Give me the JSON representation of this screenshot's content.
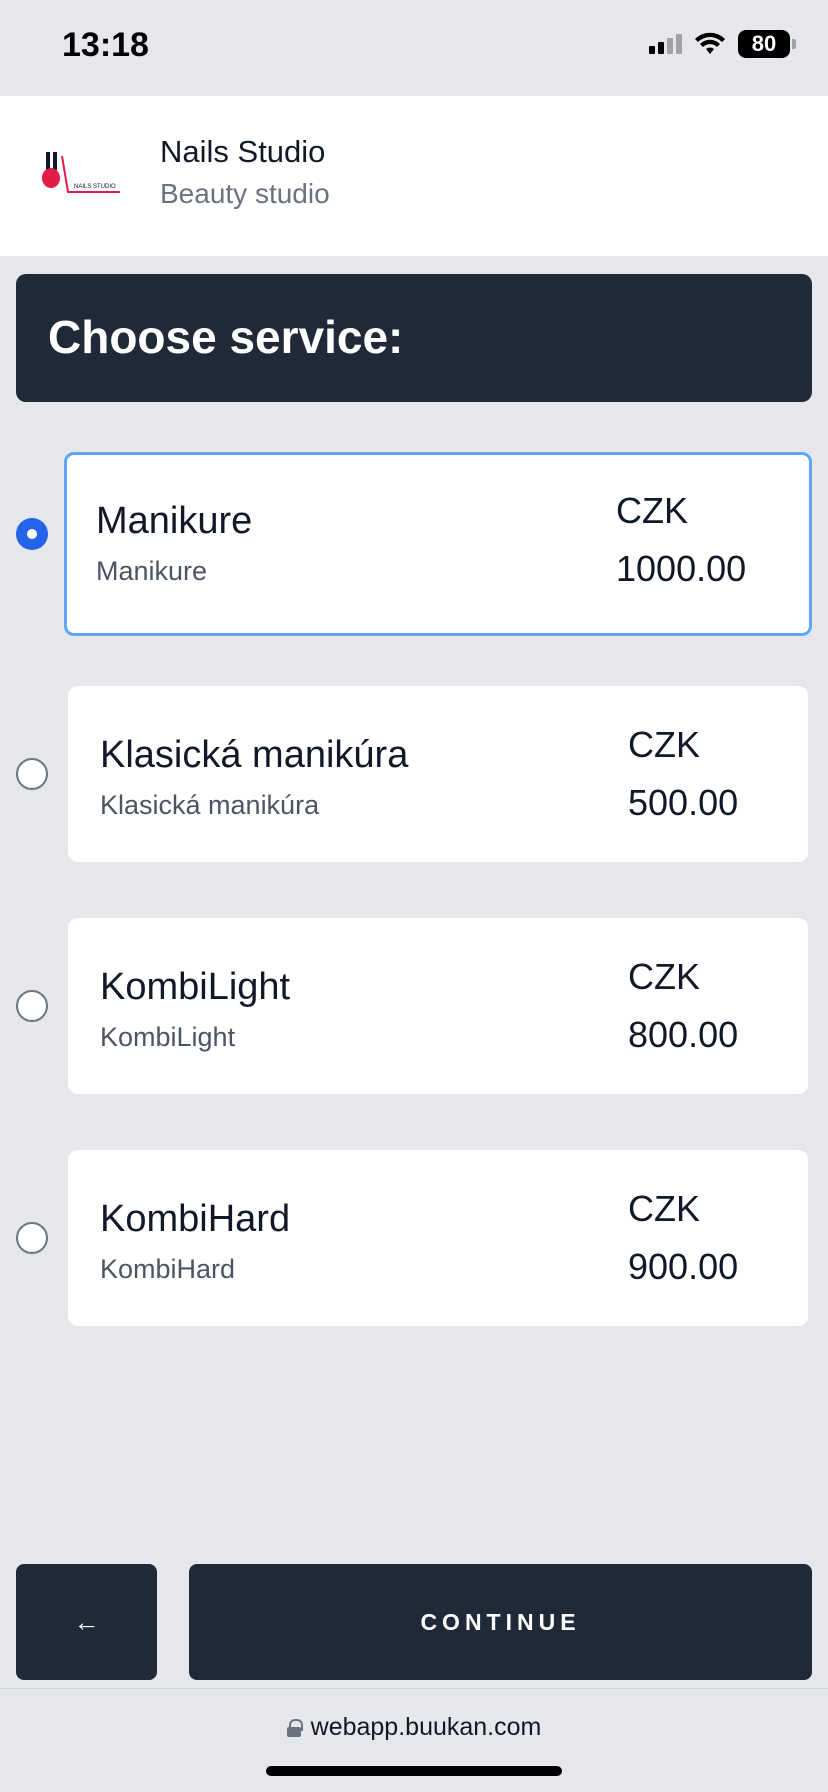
{
  "status_bar": {
    "time": "13:18",
    "battery": "80"
  },
  "header": {
    "studio_name": "Nails Studio",
    "studio_type": "Beauty studio",
    "logo_text": "NAILS STUDIO"
  },
  "page": {
    "title": "Choose service:"
  },
  "services": [
    {
      "name": "Manikure",
      "description": "Manikure",
      "currency": "CZK",
      "price": "1000.00",
      "selected": true
    },
    {
      "name": "Klasická manikúra",
      "description": "Klasická manikúra",
      "currency": "CZK",
      "price": "500.00",
      "selected": false
    },
    {
      "name": "KombiLight",
      "description": "KombiLight",
      "currency": "CZK",
      "price": "800.00",
      "selected": false
    },
    {
      "name": "KombiHard",
      "description": "KombiHard",
      "currency": "CZK",
      "price": "900.00",
      "selected": false
    }
  ],
  "footer": {
    "back_label": "←",
    "continue_label": "CONTINUE"
  },
  "browser": {
    "url": "webapp.buukan.com"
  },
  "colors": {
    "primary_dark": "#1f2937",
    "accent": "#2563eb",
    "selected_border": "#60a5fa",
    "logo_pink": "#e11d48"
  }
}
